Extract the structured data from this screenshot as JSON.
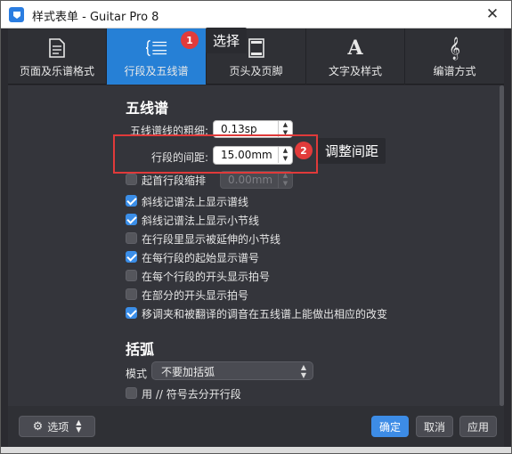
{
  "window": {
    "title": "样式表单 - Guitar Pro 8"
  },
  "tabs": [
    {
      "label": "页面及乐谱格式",
      "icon": "page-icon"
    },
    {
      "label": "行段及五线谱",
      "icon": "staff-system-icon",
      "active": true
    },
    {
      "label": "页头及页脚",
      "icon": "header-footer-icon"
    },
    {
      "label": "文字及样式",
      "icon": "text-style-icon"
    },
    {
      "label": "编谱方式",
      "icon": "treble-clef-icon"
    }
  ],
  "staff_section": {
    "title": "五线谱",
    "line_width_label": "五线谱线的粗细:",
    "line_width_value": "0.13sp",
    "system_spacing_label": "行段的间距:",
    "system_spacing_value": "15.00mm",
    "first_indent_label": "起首行段缩排",
    "first_indent_value": "0.00mm",
    "checkboxes": [
      {
        "label": "斜线记谱法上显示谱线",
        "checked": true
      },
      {
        "label": "斜线记谱法上显示小节线",
        "checked": true
      },
      {
        "label": "在行段里显示被延伸的小节线",
        "checked": false
      },
      {
        "label": "在每行段的起始显示谱号",
        "checked": true
      },
      {
        "label": "在每个行段的开头显示拍号",
        "checked": false
      },
      {
        "label": "在部分的开头显示拍号",
        "checked": false
      },
      {
        "label": "移调夹和被翻译的调音在五线谱上能做出相应的改变",
        "checked": true
      }
    ]
  },
  "bracket_section": {
    "title": "括弧",
    "mode_label": "模式",
    "mode_value": "不要加括弧",
    "split_label": "用 // 符号去分开行段",
    "split_checked": false
  },
  "annotations": {
    "marker1": "1",
    "callout1": "选择",
    "marker2": "2",
    "callout2": "调整间距",
    "color": "#e23b3b"
  },
  "footer": {
    "options_label": "选项",
    "ok_label": "确定",
    "cancel_label": "取消",
    "apply_label": "应用"
  },
  "colors": {
    "accent": "#2680d6",
    "panel": "#34353b",
    "checkbox_on": "#3b8ee8"
  }
}
